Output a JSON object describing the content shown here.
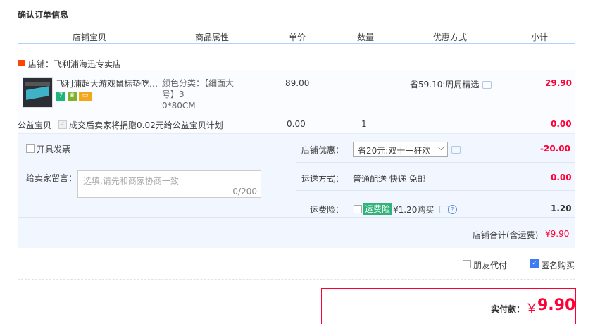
{
  "page_title": "确认订单信息",
  "columns": [
    "店铺宝贝",
    "商品属性",
    "单价",
    "数量",
    "优惠方式",
    "小计"
  ],
  "shop": {
    "label": "店铺：飞利浦海迅专卖店"
  },
  "item": {
    "name": "飞利浦超大游戏鼠标垫吃…",
    "props_line1": "颜色分类：【细面大号】3",
    "props_line2": "0*80CM",
    "price": "89.00",
    "discount": "省59.10:周周精选",
    "subtotal": "29.90",
    "badges": [
      {
        "text": "7",
        "color": "#1fb47a"
      },
      {
        "text": "♛",
        "color": "#7fb22c"
      },
      {
        "text": "▭",
        "color": "#f3a71c"
      }
    ]
  },
  "charity": {
    "label": "公益宝贝",
    "text": "成交后卖家将捐赠0.02元给公益宝贝计划",
    "price": "0.00",
    "qty": "1",
    "subtotal": "0.00"
  },
  "invoice": {
    "label": "开具发票"
  },
  "message": {
    "label": "给卖家留言：",
    "placeholder": "选填,请先和商家协商一致",
    "counter": "0/200"
  },
  "shop_discount": {
    "label": "店铺优惠：",
    "selected": "省20元:双十一狂欢",
    "value": "-20.00"
  },
  "shipping": {
    "label": "运送方式：",
    "text": "普通配送 快递 免邮",
    "value": "0.00"
  },
  "insurance": {
    "label": "运费险：",
    "tag": "运费险",
    "text": "¥1.20购买",
    "value": "1.20"
  },
  "shop_total": {
    "label": "店铺合计(含运费)",
    "value": "¥9.90"
  },
  "options": {
    "friend_pay": "朋友代付",
    "anonymous": "匿名购买"
  },
  "payment": {
    "label": "实付款：",
    "currency": "￥",
    "amount": "9.90"
  }
}
